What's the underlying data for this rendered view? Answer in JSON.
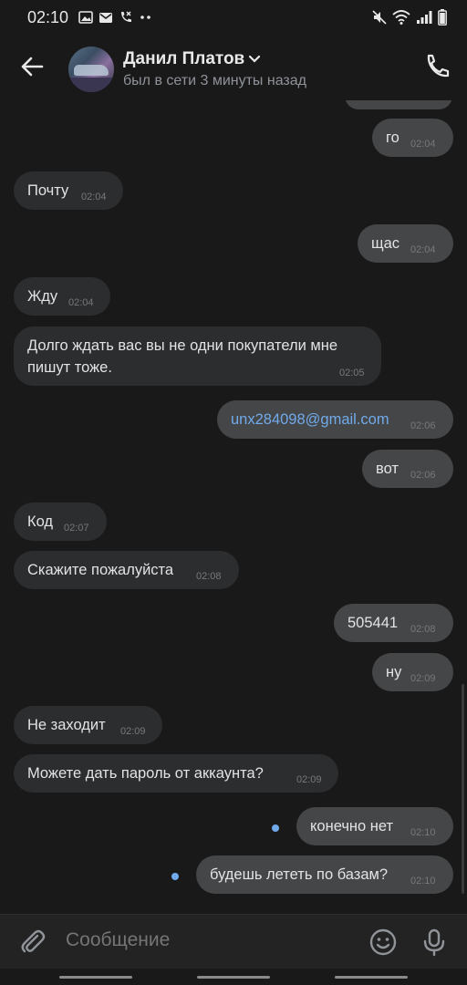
{
  "status_bar": {
    "time": "02:10",
    "left_icons": [
      "image-icon",
      "mail-icon",
      "missed-call-icon",
      "more-dots-icon"
    ],
    "right_icons": [
      "mute-icon",
      "wifi-icon",
      "signal-icon",
      "battery-icon"
    ]
  },
  "header": {
    "contact_name": "Данил Платов",
    "contact_status": "был в сети 3 минуты назад"
  },
  "messages": [
    {
      "id": "m1",
      "direction": "out",
      "text": "го",
      "time": "02:04"
    },
    {
      "id": "m2",
      "direction": "in",
      "text": "Почту",
      "time": "02:04"
    },
    {
      "id": "m3",
      "direction": "out",
      "text": "щас",
      "time": "02:04"
    },
    {
      "id": "m4",
      "direction": "in",
      "text": "Жду",
      "time": "02:04"
    },
    {
      "id": "m5",
      "direction": "in",
      "text_line1": "Долго ждать вас вы не одни покупатели мне",
      "text_line2": "пишут тоже.",
      "time": "02:05"
    },
    {
      "id": "m6",
      "direction": "out",
      "text": "unx284098@gmail.com",
      "time": "02:06"
    },
    {
      "id": "m7",
      "direction": "out",
      "text": "вот",
      "time": "02:06"
    },
    {
      "id": "m8",
      "direction": "in",
      "text": "Код",
      "time": "02:07"
    },
    {
      "id": "m9",
      "direction": "in",
      "text": "Скажите пожалуйста",
      "time": "02:08"
    },
    {
      "id": "m10",
      "direction": "out",
      "text": "505441",
      "time": "02:08"
    },
    {
      "id": "m11",
      "direction": "out",
      "text": "ну",
      "time": "02:09"
    },
    {
      "id": "m12",
      "direction": "in",
      "text": "Не заходит",
      "time": "02:09"
    },
    {
      "id": "m13",
      "direction": "in",
      "text": "Можете дать пароль от аккаунта?",
      "time": "02:09"
    },
    {
      "id": "m14",
      "direction": "out",
      "text": "конечно нет",
      "time": "02:10",
      "unread": true
    },
    {
      "id": "m15",
      "direction": "out",
      "text": "будешь лететь по базам?",
      "time": "02:10",
      "unread": true
    }
  ],
  "composer": {
    "placeholder": "Сообщение"
  },
  "colors": {
    "background": "#19191a",
    "incoming_bubble": "#2c2d2e",
    "outgoing_bubble": "#454647",
    "link": "#71aaeb",
    "unread_dot": "#71aaeb"
  }
}
